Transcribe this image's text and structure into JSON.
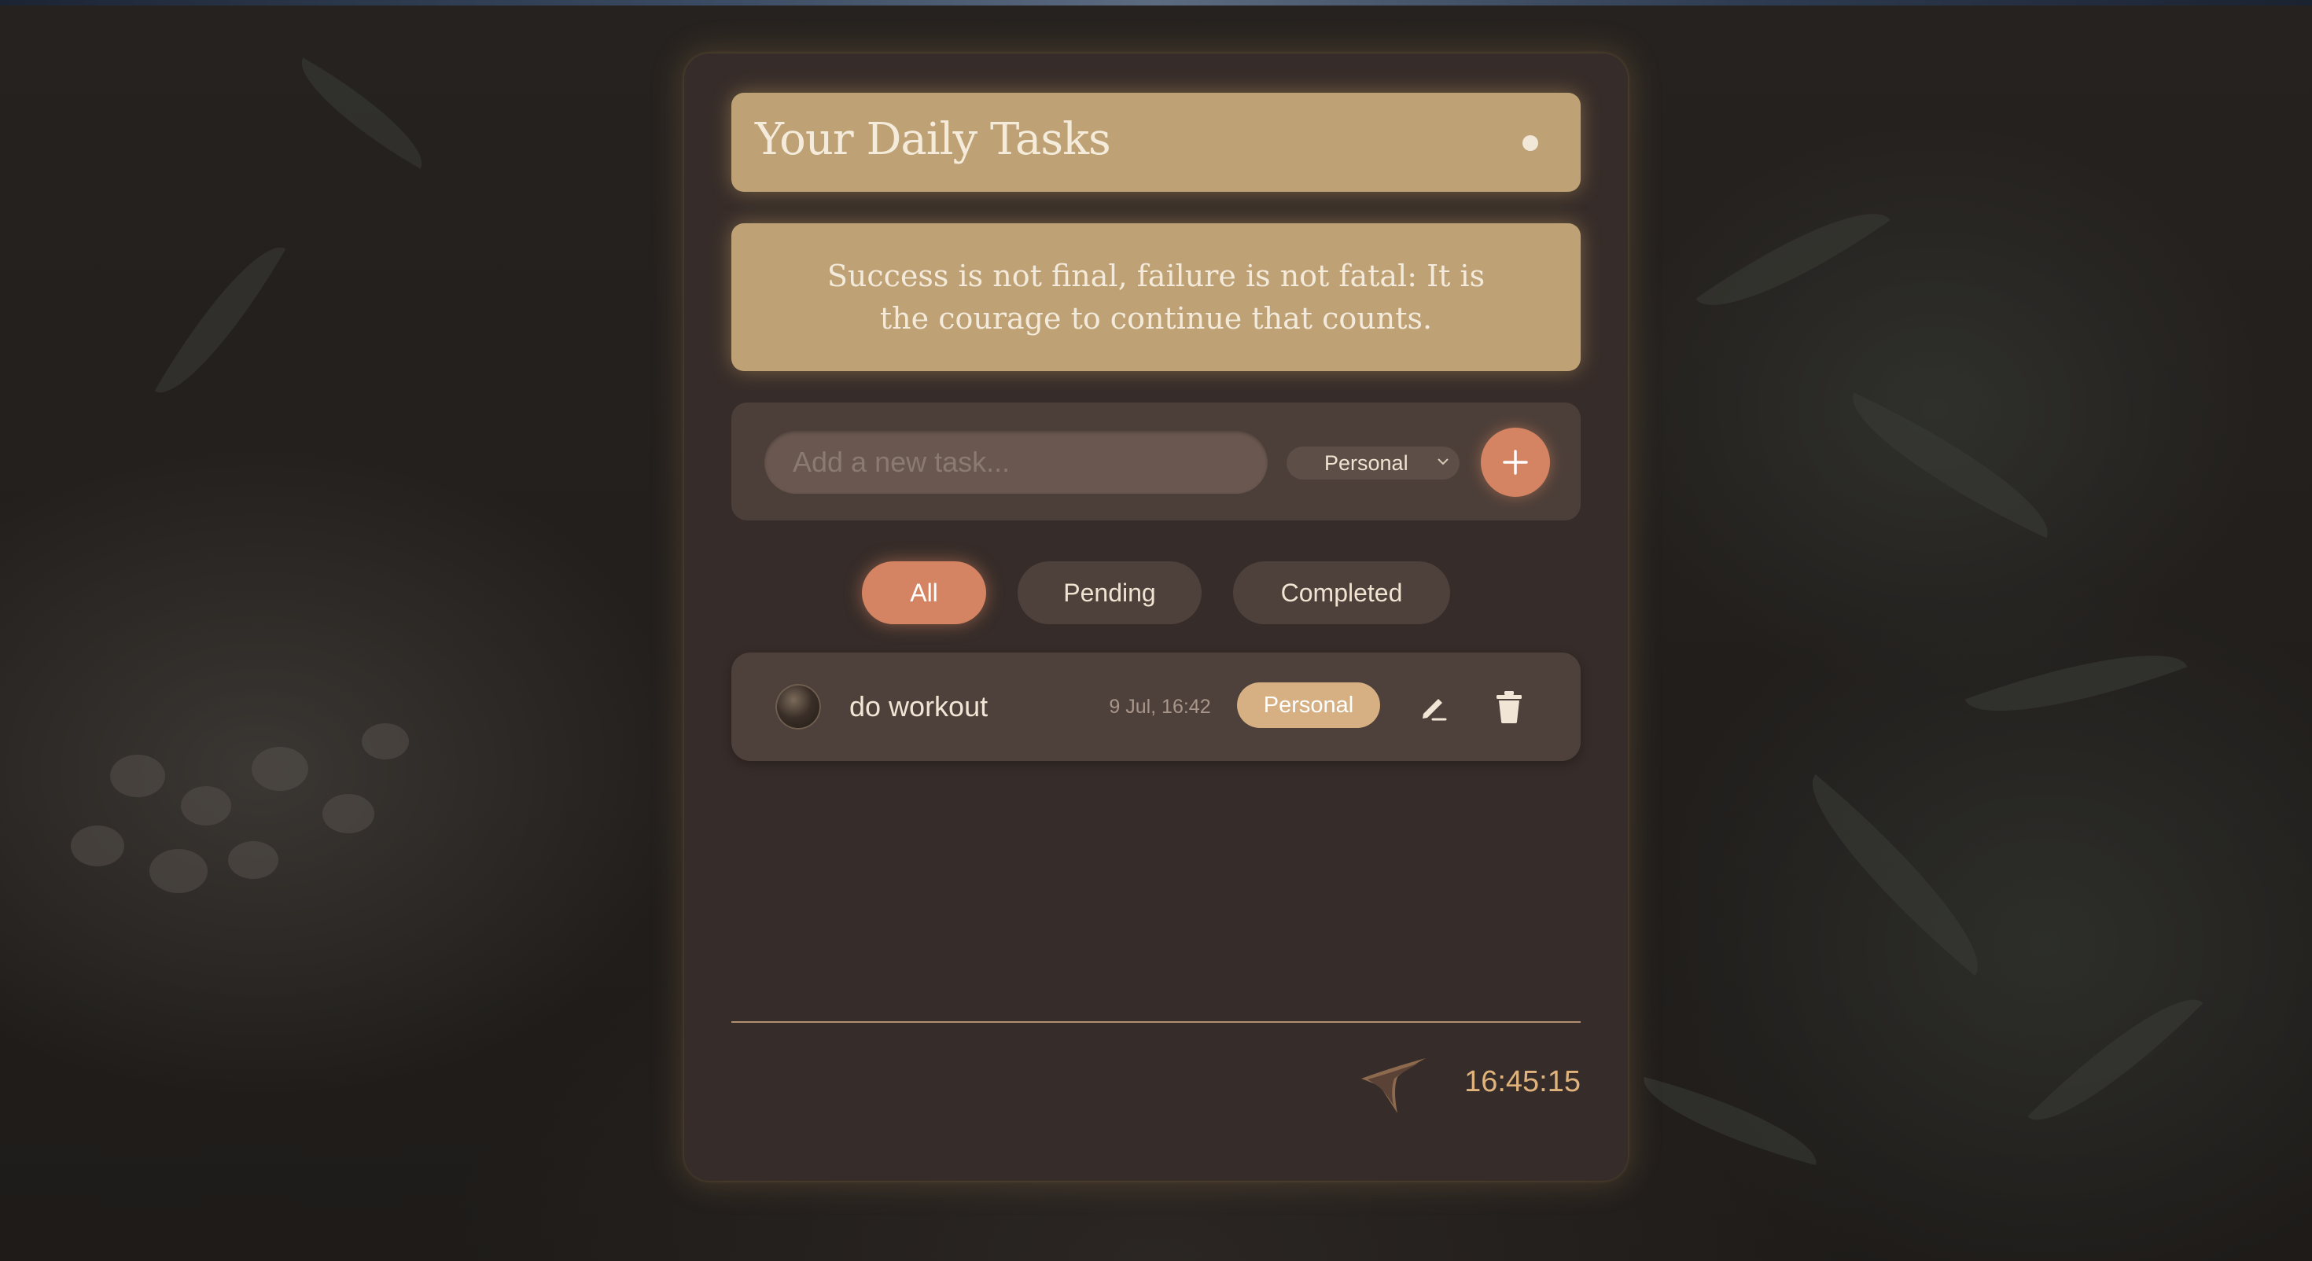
{
  "header": {
    "title": "Your Daily Tasks"
  },
  "quote": {
    "text": "Success is not final, failure is not fatal: It is the courage to continue that counts."
  },
  "add_task": {
    "placeholder": "Add a new task...",
    "value": "",
    "category_selected": "Personal",
    "add_icon": "plus-icon"
  },
  "filters": [
    {
      "label": "All",
      "active": true
    },
    {
      "label": "Pending",
      "active": false
    },
    {
      "label": "Completed",
      "active": false
    }
  ],
  "tasks": [
    {
      "title": "do workout",
      "date": "9 Jul, 16:42",
      "category": "Personal",
      "completed": false,
      "icons": [
        "pencil-icon",
        "trash-icon"
      ]
    }
  ],
  "footer": {
    "logo_icon": "arrow-logo-icon",
    "clock": "16:45:15"
  },
  "colors": {
    "accent": "#d48462",
    "header_bg": "#bea174",
    "card_bg": "#362c29",
    "tag_bg": "#d6b083",
    "clock_text": "#e0b37c"
  }
}
